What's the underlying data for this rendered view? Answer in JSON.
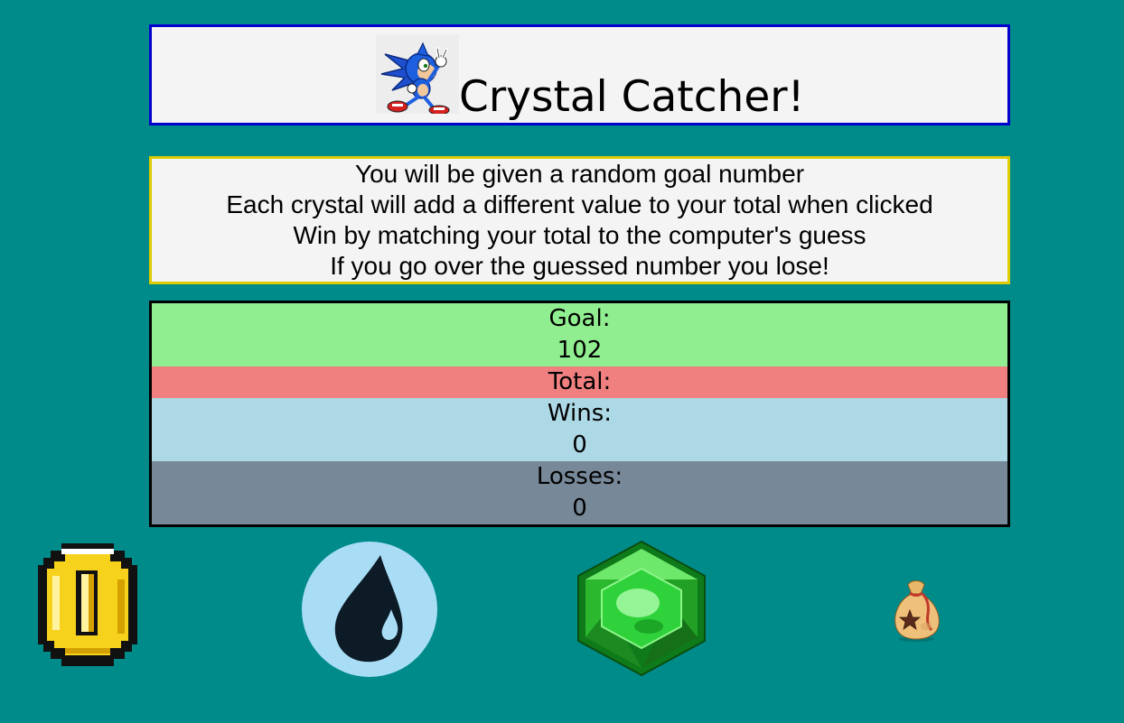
{
  "header": {
    "title": "Crystal Catcher!",
    "icon": "hedgehog-mascot-icon"
  },
  "instructions": {
    "lines": [
      "You will be given a random goal number",
      "Each crystal will add a different value to your total when clicked",
      "Win by matching your total to the computer's guess",
      "If you go over the guessed number you lose!"
    ]
  },
  "scoreboard": {
    "goal_label": "Goal:",
    "goal_value": "102",
    "total_label": "Total:",
    "total_value": "",
    "wins_label": "Wins:",
    "wins_value": "0",
    "losses_label": "Losses:",
    "losses_value": "0"
  },
  "crystals": [
    {
      "name": "gold-coin-icon"
    },
    {
      "name": "water-drop-icon"
    },
    {
      "name": "green-emerald-icon"
    },
    {
      "name": "money-bag-icon"
    }
  ],
  "colors": {
    "background": "#008B8B",
    "panel": "#F4F4F4",
    "header_border": "#0000CD",
    "instructions_border": "#DDCC00",
    "goal_row": "#90EE90",
    "total_row": "#F08080",
    "wins_row": "#ADD8E6",
    "losses_row": "#778899"
  }
}
